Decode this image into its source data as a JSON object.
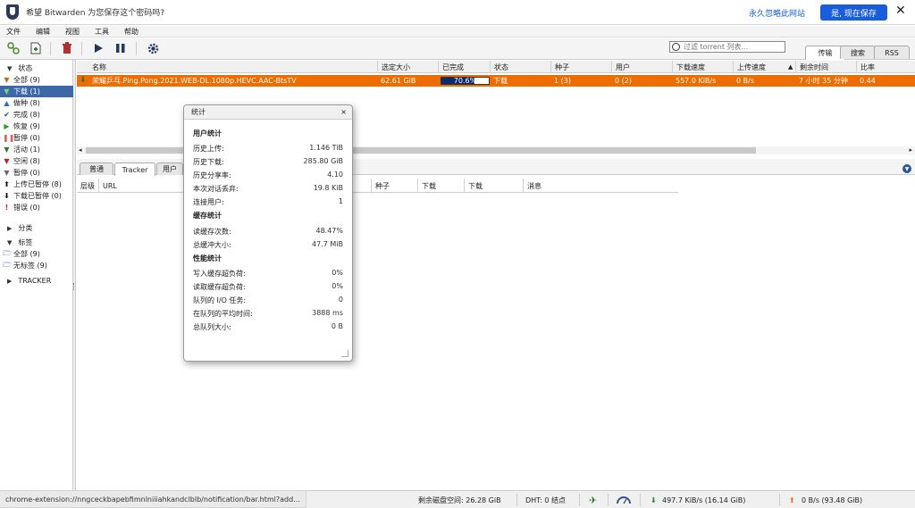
{
  "bitwarden": {
    "message": "希望 Bitwarden 为您保存这个密码吗?",
    "never_link": "永久忽略此网站",
    "save_button": "是, 现在保存",
    "close": "✕"
  },
  "menu": [
    "文件",
    "编辑",
    "视图",
    "工具",
    "帮助"
  ],
  "search": {
    "placeholder": "过滤 torrent 列表..."
  },
  "right_tabs": [
    "传输",
    "搜索",
    "RSS"
  ],
  "sidebar": {
    "status_header": "状态",
    "status_items": [
      {
        "label": "全部 (9)",
        "icon": "filter-icon"
      },
      {
        "label": "下载 (1)",
        "icon": "download-icon"
      },
      {
        "label": "做种 (8)",
        "icon": "upload-icon"
      },
      {
        "label": "完成 (8)",
        "icon": "check-icon"
      },
      {
        "label": "恢复 (9)",
        "icon": "play-icon"
      },
      {
        "label": "暂停 (0)",
        "icon": "pause-icon"
      },
      {
        "label": "活动 (1)",
        "icon": "filter-icon"
      },
      {
        "label": "空闲 (8)",
        "icon": "filter-icon"
      },
      {
        "label": "暂停 (0)",
        "icon": "filter-icon"
      },
      {
        "label": "上传已暂停 (8)",
        "icon": "up-arrow-icon"
      },
      {
        "label": "下载已暂停 (0)",
        "icon": "down-arrow-icon"
      },
      {
        "label": "错误 (0)",
        "icon": "error-icon"
      }
    ],
    "category_header": "分类",
    "tag_header": "标签",
    "tag_items": [
      "全部 (9)",
      "无标签 (9)"
    ],
    "tracker_header": "TRACKER"
  },
  "table": {
    "columns": [
      "名称",
      "选定大小",
      "已完成",
      "状态",
      "种子",
      "用户",
      "下载速度",
      "上传速度",
      "剩余时间",
      "比率"
    ],
    "row": {
      "name": "荣耀乒乓.Ping.Pong.2021.WEB-DL.1080p.HEVC.AAC-BtsTV",
      "size": "62.61 GiB",
      "progress_label": "70.6%",
      "progress": 70.6,
      "status": "下载",
      "seeds": "1 (3)",
      "peers": "0 (2)",
      "down_speed": "557.0 KiB/s",
      "up_speed": "0 B/s",
      "eta": "7 小时 35 分钟",
      "ratio": "0.44"
    }
  },
  "lower_tabs": [
    "普通",
    "Tracker",
    "用户"
  ],
  "tracker_columns": [
    "层级",
    "URL",
    "种子",
    "下载",
    "下载",
    "消息"
  ],
  "stats": {
    "title": "统计",
    "close": "×",
    "user_header": "用户统计",
    "user": [
      {
        "k": "历史上传:",
        "v": "1.146 TiB"
      },
      {
        "k": "历史下载:",
        "v": "285.80 GiB"
      },
      {
        "k": "历史分享率:",
        "v": "4.10"
      },
      {
        "k": "本次对话丢弃:",
        "v": "19.8 KiB"
      },
      {
        "k": "连接用户:",
        "v": "1"
      }
    ],
    "cache_header": "缓存统计",
    "cache": [
      {
        "k": "读缓存次数:",
        "v": "48.47%"
      },
      {
        "k": "总缓冲大小:",
        "v": "47.7 MiB"
      }
    ],
    "perf_header": "性能统计",
    "perf": [
      {
        "k": "写入缓存超负荷:",
        "v": "0%"
      },
      {
        "k": "读取缓存超负荷:",
        "v": "0%"
      },
      {
        "k": "队列的 I/O 任务:",
        "v": "0"
      },
      {
        "k": "在队列的平均时间:",
        "v": "3888 ms"
      },
      {
        "k": "总队列大小:",
        "v": "0 B"
      }
    ]
  },
  "statusbar": {
    "url": "chrome-extension://nngceckbapebfimnlniiiahkandclblb/notification/bar.html?add...",
    "disk": "剩余磁盘空间: 26.28 GiB",
    "dht": "DHT: 0 结点",
    "down": "497.7 KiB/s (16.14 GiB)",
    "up": "0 B/s (93.48 GiB)"
  },
  "colors": {
    "accent": "#175ddc",
    "selected_row": "#ef6c00",
    "sidebar_selected": "#3d68a8"
  }
}
